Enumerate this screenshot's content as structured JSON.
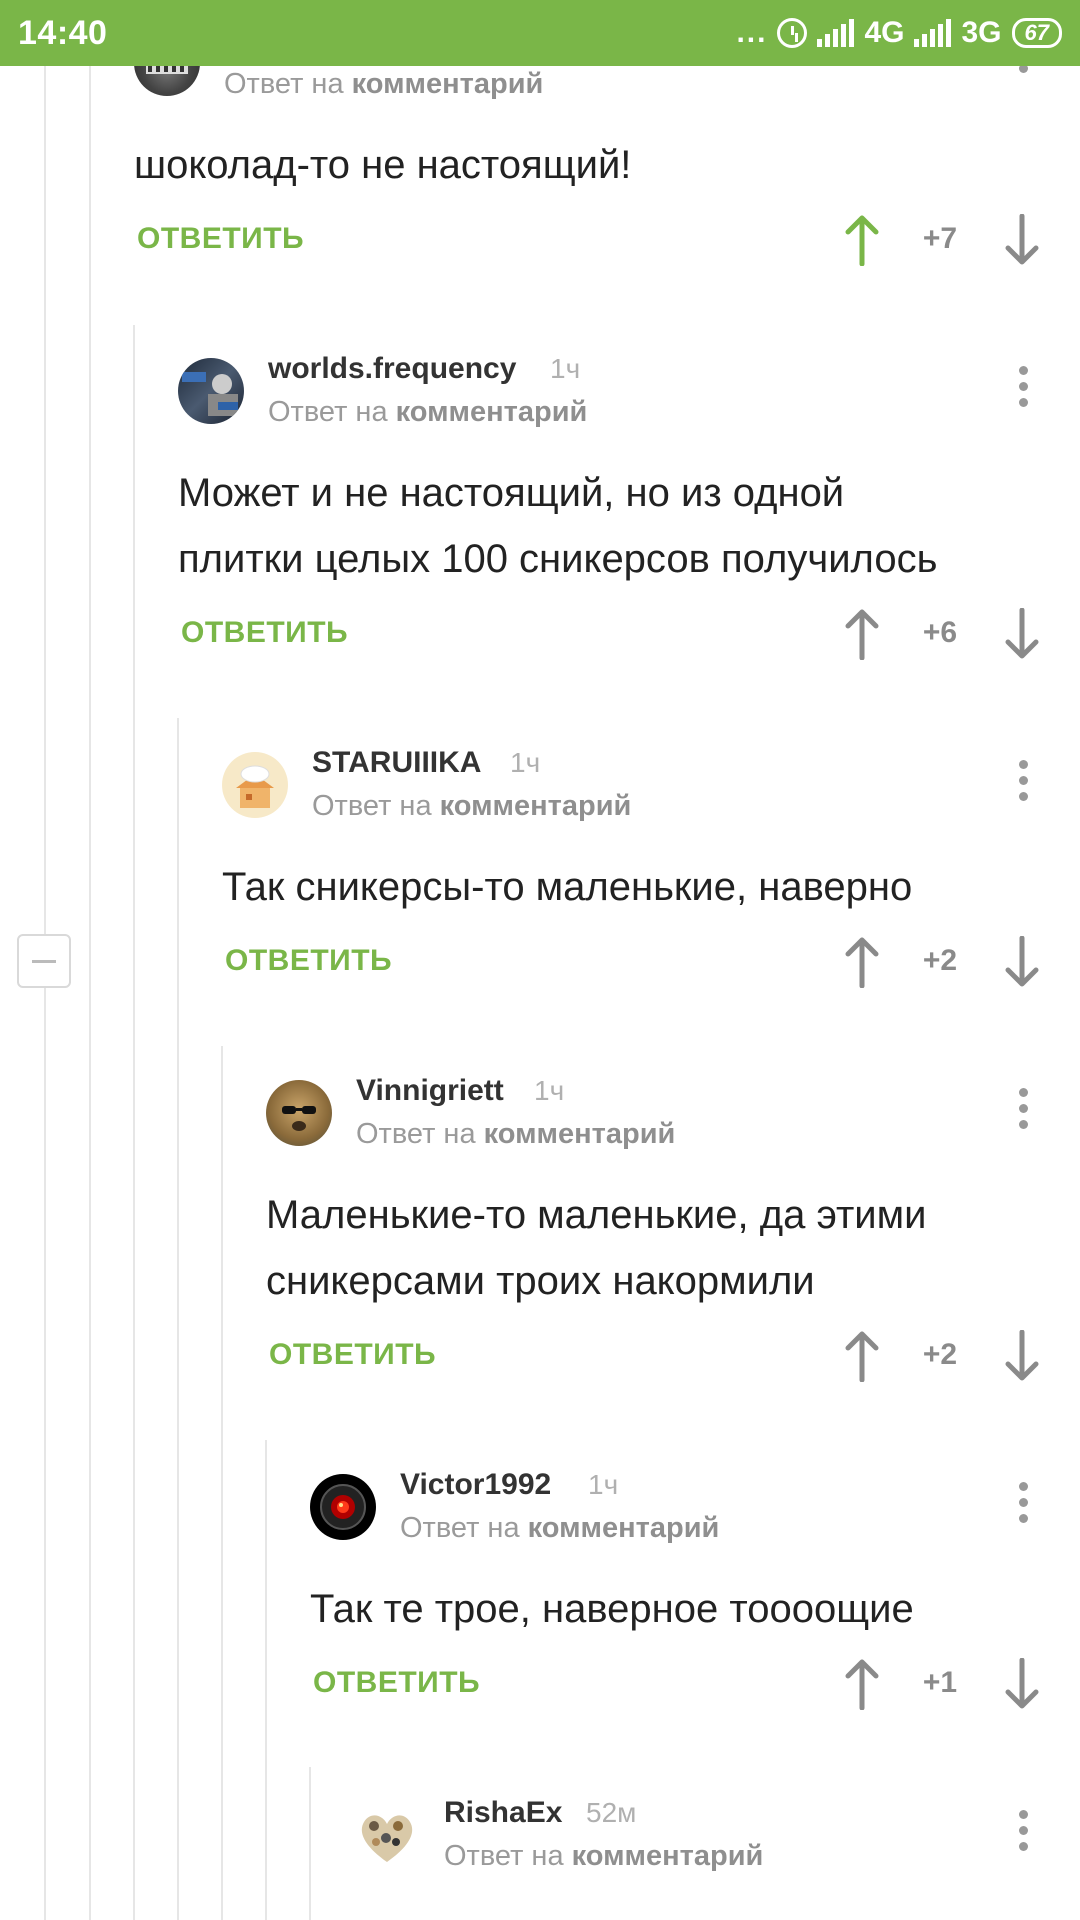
{
  "status_bar": {
    "time": "14:40",
    "dots": "...",
    "net1": "4G",
    "net2": "3G",
    "battery": "67"
  },
  "ui": {
    "reply_prefix": "Ответ на",
    "reply_target": "комментарий",
    "reply_button": "ОТВЕТИТЬ"
  },
  "comments": [
    {
      "user": "",
      "time": "",
      "text": [
        "шоколад-то не настоящий!"
      ],
      "score": "+7",
      "voted_up": true,
      "avatar": "robot"
    },
    {
      "user": "worlds.frequency",
      "time": "1ч",
      "text": [
        "Может и не настоящий, но из одной",
        "плитки целых 100 сникерсов получилось"
      ],
      "score": "+6",
      "voted_up": false,
      "avatar": "photo-dark"
    },
    {
      "user": "STARUIIIKA",
      "time": "1ч",
      "text": [
        "Так сникерсы-то маленькие, наверно"
      ],
      "score": "+2",
      "voted_up": false,
      "avatar": "house"
    },
    {
      "user": "Vinnigriett",
      "time": "1ч",
      "text": [
        "Маленькие-то маленькие, да этими",
        "сникерсами троих накормили"
      ],
      "score": "+2",
      "voted_up": false,
      "avatar": "dog"
    },
    {
      "user": "Victor1992",
      "time": "1ч",
      "text": [
        "Так те трое, наверное тоооощие"
      ],
      "score": "+1",
      "voted_up": false,
      "avatar": "hal"
    },
    {
      "user": "RishaEx",
      "time": "52м",
      "text": [],
      "score": "",
      "voted_up": false,
      "avatar": "cats-heart"
    }
  ],
  "colors": {
    "accent": "#7ab648",
    "text": "#222222",
    "muted": "#9a9a9a",
    "score": "#8a8a8a"
  }
}
